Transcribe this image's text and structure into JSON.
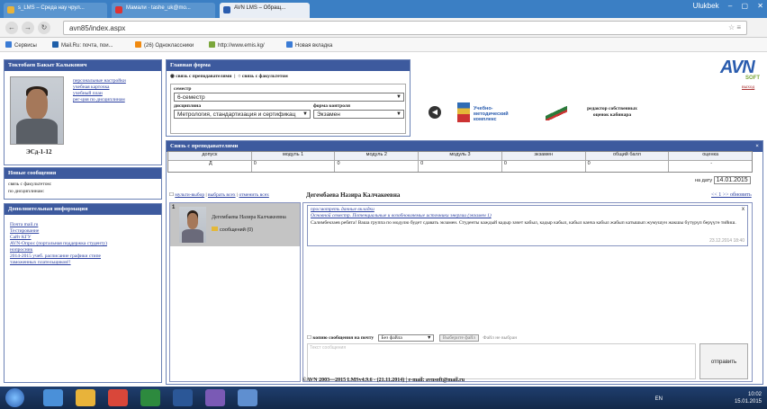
{
  "browser": {
    "tabs": [
      {
        "label": "s_LMS – Среда нау чрул...",
        "active": false,
        "favicon_color": "#e8b33a"
      },
      {
        "label": "Мамали · tashe_uk@mo...",
        "active": false,
        "favicon_color": "#d33"
      },
      {
        "label": "AVN LMS – Обращ...",
        "active": true,
        "favicon_color": "#2a5cae"
      }
    ],
    "window_user": "Ulukbek",
    "url": "avn85/index.aspx",
    "bookmarks": [
      {
        "label": "Сервисы",
        "color": "#3a7bd5"
      },
      {
        "label": "Mail.Ru: почта, пои...",
        "color": "#1f5fa8"
      },
      {
        "label": "(26) Одноклассники",
        "color": "#f08a10"
      },
      {
        "label": "http://www.emis.kg/",
        "color": "#7aa63a"
      },
      {
        "label": "Новая вкладка",
        "color": "#3a7bd5"
      }
    ]
  },
  "profile": {
    "header": "Токтобаев Бакыт Калыкович",
    "links": [
      "персональные настройки",
      "учебная карточка",
      "учебный план",
      "рег-ция по дисциплинам"
    ],
    "group": "ЭСд-1-12"
  },
  "news": {
    "header": "Новые сообщения",
    "items": [
      "связь с факультетом:",
      "по дисциплинам:"
    ]
  },
  "extra": {
    "header": "Дополнительная информация",
    "links": [
      "Почта mail.ru",
      "Тестирование",
      "Сайт КГУ",
      "AVN-Опрос (портальная поддержка студенту)",
      "нопросник",
      "2014-2015 учеб. расписание графики стипе",
      "таможенных плательщиков!!"
    ]
  },
  "main": {
    "header": "Главная форма",
    "radio_teacher": "связь с преподавателями",
    "radio_faculty": "связь с факультетом",
    "semester_label": "семестр",
    "semester_value": "6-семестр",
    "discipline_label": "дисциплина",
    "discipline_value": "Метрология, стандартизация и сертификац",
    "control_label": "форма контроля",
    "control_value": "Экзамен",
    "tool_umk": "Учебно-методический комплекс",
    "tool_editor": "редактор собственных оценок кабинара",
    "logo_text": "AVN",
    "logo_sub": "SOFT",
    "logout": "выход"
  },
  "teachers": {
    "header": "Связь с преподавателями",
    "columns": [
      "допуск",
      "модуль 1",
      "модуль 2",
      "модуль 3",
      "экзамен",
      "общий балл",
      "оценка"
    ],
    "values": [
      "Д",
      "0",
      "0",
      "0",
      "0",
      "0",
      "-"
    ],
    "date_label": "на дату",
    "date_value": "14.01.2015",
    "multi_select": "мульти-выбор",
    "select_all": "выбрать всех",
    "deselect_all": "отменить всех",
    "selected_name": "Дегембаева Назира Калчакеевна",
    "pager": "<< 1 >> обновить",
    "contact": {
      "index": "1",
      "name": "Дегембаева Назира Калчакеевна",
      "unread": "сообщений (0)"
    },
    "message": {
      "link1": "просмотреть данные вкладки",
      "link2": "Основной семестр. Потенциальные и возобновляемые источники энергии (экзамен 1)",
      "text": "Салимбекзаев ребята! Ваша группа по модулю будет сдавать экзамен. Студенты каждый кадыр зачет кабыл, кадыр кабыл, кабыл канча кабыл жабып катышып жумушун жакшы бүтүрүп берүүгө тийиш.",
      "time": "23.12.2014 18:40"
    },
    "mail_label": "копию сообщения на почту",
    "file_option": "Без файла",
    "file_button": "Выберите файл",
    "file_status": "Файл не выбран",
    "placeholder": "Текст сообщения",
    "send": "отправить"
  },
  "footer": "©AVN 2003—2015 LMSv4.9.6 - (21.11.2014) | e-mail: avnsoft@mail.ru",
  "system": {
    "lang": "EN",
    "time": "10:02",
    "date": "15.01.2015"
  }
}
